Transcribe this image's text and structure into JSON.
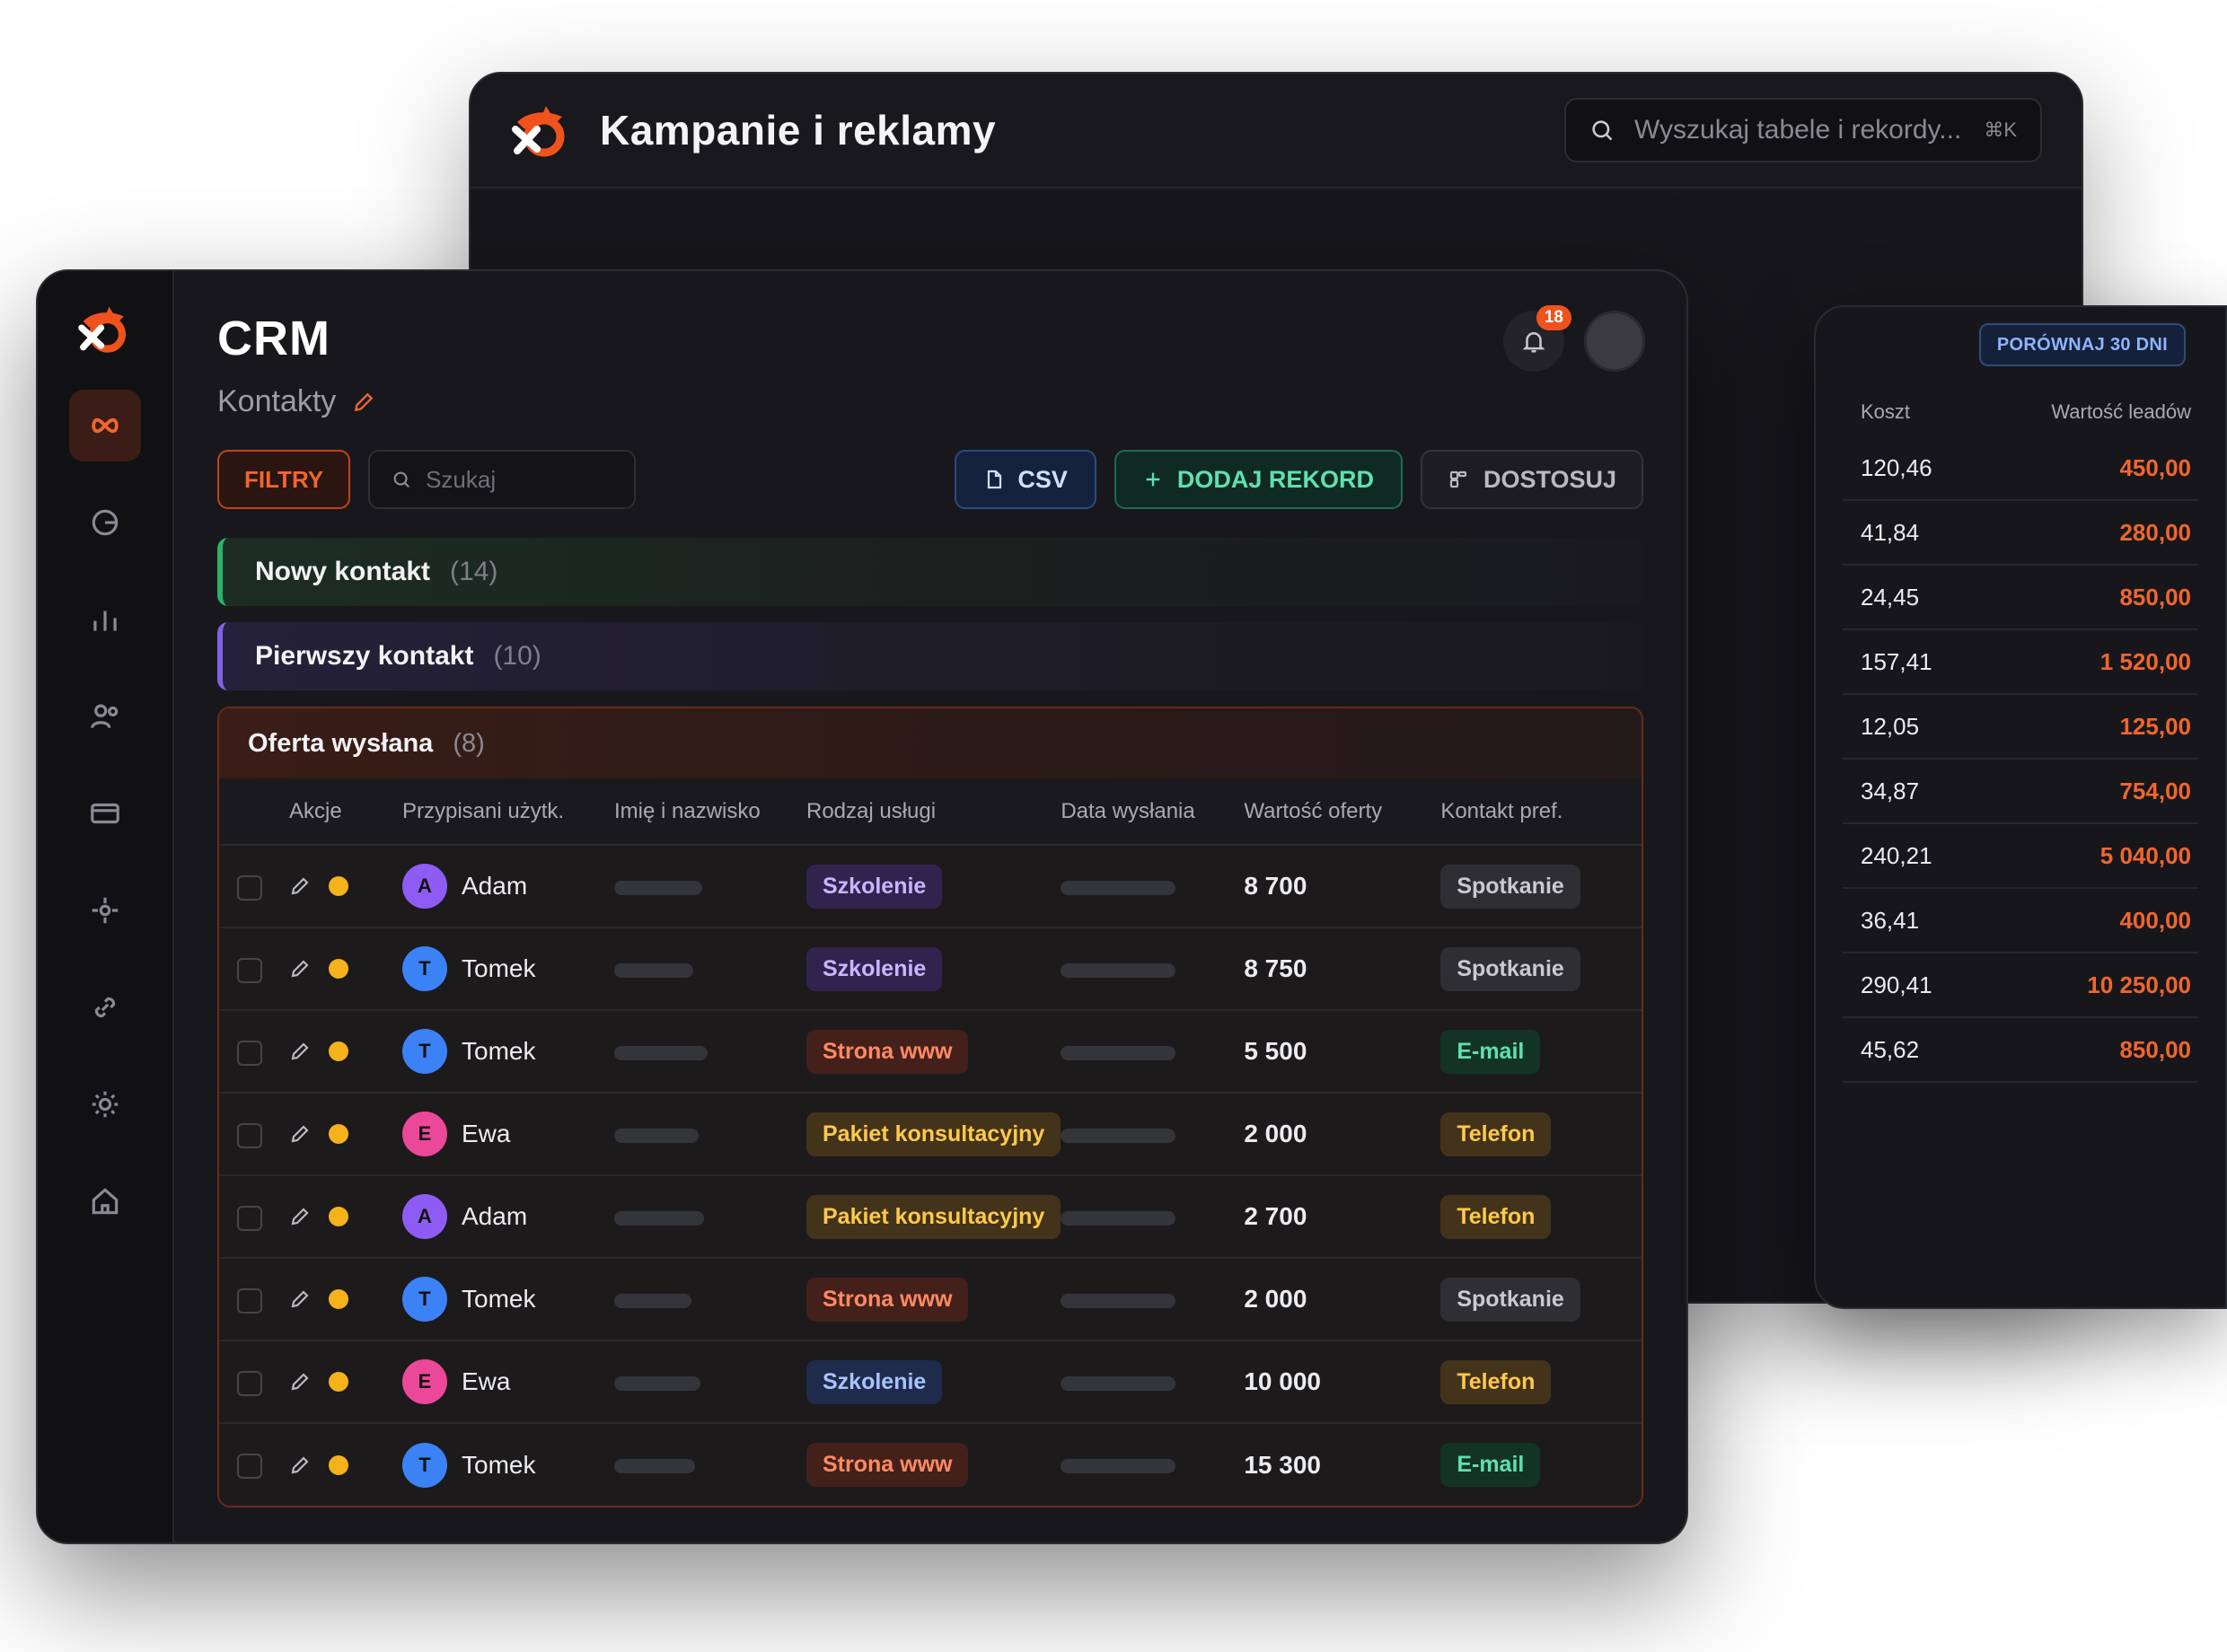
{
  "back_window": {
    "title": "Kampanie i reklamy",
    "search_placeholder": "Wyszukaj tabele i rekordy...",
    "search_shortcut": "⌘K"
  },
  "right_panel": {
    "compare_button": "PORÓWNAJ 30 DNI",
    "col_cost": "Koszt",
    "col_value": "Wartość leadów",
    "rows": [
      {
        "cost": "120,46",
        "value": "450,00"
      },
      {
        "cost": "41,84",
        "value": "280,00"
      },
      {
        "cost": "24,45",
        "value": "850,00"
      },
      {
        "cost": "157,41",
        "value": "1 520,00"
      },
      {
        "cost": "12,05",
        "value": "125,00"
      },
      {
        "cost": "34,87",
        "value": "754,00"
      },
      {
        "cost": "240,21",
        "value": "5 040,00"
      },
      {
        "cost": "36,41",
        "value": "400,00"
      },
      {
        "cost": "290,41",
        "value": "10 250,00"
      },
      {
        "cost": "45,62",
        "value": "850,00"
      }
    ]
  },
  "crm": {
    "title": "CRM",
    "subtitle": "Kontakty",
    "notifications_count": "18",
    "toolbar": {
      "filters": "FILTRY",
      "search_placeholder": "Szukaj",
      "csv": "CSV",
      "add": "DODAJ REKORD",
      "customize": "DOSTOSUJ"
    },
    "groups": {
      "new_contact": {
        "label": "Nowy kontakt",
        "count": "(14)"
      },
      "first_contact": {
        "label": "Pierwszy kontakt",
        "count": "(10)"
      },
      "offer_sent": {
        "label": "Oferta wysłana",
        "count": "(8)"
      }
    },
    "columns": {
      "actions": "Akcje",
      "assigned": "Przypisani użytk.",
      "name": "Imię i nazwisko",
      "service": "Rodzaj usługi",
      "date": "Data wysłania",
      "value": "Wartość oferty",
      "contact": "Kontakt pref."
    },
    "rows": [
      {
        "initial": "A",
        "user": "Adam",
        "service": "Szkolenie",
        "value": "8 700",
        "contact": "Spotkanie"
      },
      {
        "initial": "T",
        "user": "Tomek",
        "service": "Szkolenie",
        "value": "8 750",
        "contact": "Spotkanie"
      },
      {
        "initial": "T",
        "user": "Tomek",
        "service": "Strona www",
        "value": "5 500",
        "contact": "E-mail"
      },
      {
        "initial": "E",
        "user": "Ewa",
        "service": "Pakiet konsultacyjny",
        "value": "2 000",
        "contact": "Telefon"
      },
      {
        "initial": "A",
        "user": "Adam",
        "service": "Pakiet konsultacyjny",
        "value": "2 700",
        "contact": "Telefon"
      },
      {
        "initial": "T",
        "user": "Tomek",
        "service": "Strona www",
        "value": "2 000",
        "contact": "Spotkanie"
      },
      {
        "initial": "E",
        "user": "Ewa",
        "service": "Szkolenie",
        "value": "10 000",
        "contact": "Telefon"
      },
      {
        "initial": "T",
        "user": "Tomek",
        "service": "Strona www",
        "value": "15 300",
        "contact": "E-mail"
      }
    ]
  }
}
